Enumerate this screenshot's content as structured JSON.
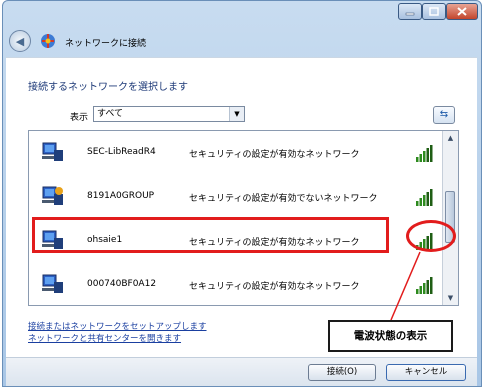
{
  "window": {
    "title": "ネットワークに接続",
    "controls": {
      "minimize": "minimize",
      "maximize": "maximize",
      "close": "x"
    }
  },
  "header": {
    "instruction": "接続するネットワークを選択します"
  },
  "filter": {
    "label": "表示",
    "selected": "すべて"
  },
  "networks": [
    {
      "name": "SEC-LibReadR4",
      "security": "セキュリティの設定が有効なネットワーク",
      "signal_bars": 5
    },
    {
      "name": "8191A0GROUP",
      "security": "セキュリティの設定が有効でないネットワーク",
      "signal_bars": 5
    },
    {
      "name": "ohsaie1",
      "security": "セキュリティの設定が有効なネットワーク",
      "signal_bars": 5
    },
    {
      "name": "000740BF0A12",
      "security": "セキュリティの設定が有効なネットワーク",
      "signal_bars": 5
    }
  ],
  "links": {
    "setup": "接続またはネットワークをセットアップします",
    "center": "ネットワークと共有センターを開きます"
  },
  "annotation": {
    "callout": "電波状態の表示",
    "color": "#e21c1c"
  },
  "buttons": {
    "connect": "接続(O)",
    "cancel": "キャンセル"
  }
}
